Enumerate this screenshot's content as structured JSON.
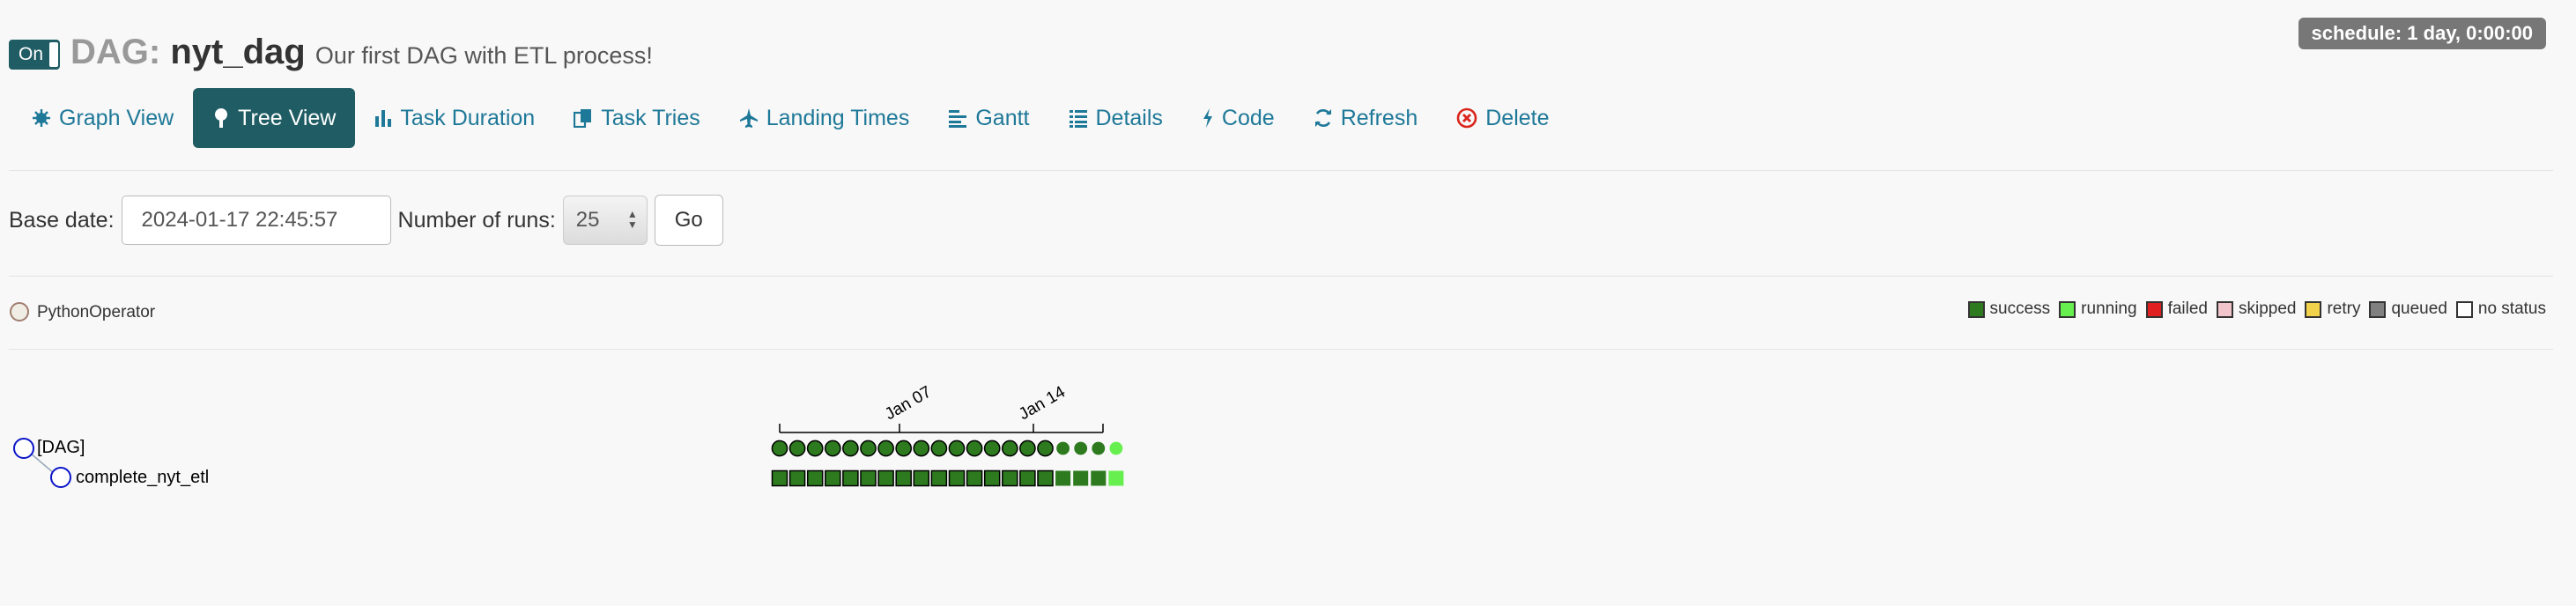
{
  "header": {
    "toggle_label": "On",
    "title_prefix": "DAG:",
    "dag_id": "nyt_dag",
    "description": "Our first DAG with ETL process!",
    "schedule": "schedule: 1 day, 0:00:00"
  },
  "tabs": [
    {
      "label": "Graph View",
      "icon": "graph-icon",
      "active": false
    },
    {
      "label": "Tree View",
      "icon": "tree-icon",
      "active": true
    },
    {
      "label": "Task Duration",
      "icon": "bar-chart-icon",
      "active": false
    },
    {
      "label": "Task Tries",
      "icon": "copy-icon",
      "active": false
    },
    {
      "label": "Landing Times",
      "icon": "plane-icon",
      "active": false
    },
    {
      "label": "Gantt",
      "icon": "align-left-icon",
      "active": false
    },
    {
      "label": "Details",
      "icon": "list-icon",
      "active": false
    },
    {
      "label": "Code",
      "icon": "flash-icon",
      "active": false
    },
    {
      "label": "Refresh",
      "icon": "refresh-icon",
      "active": false
    },
    {
      "label": "Delete",
      "icon": "remove-circle-icon",
      "active": false
    }
  ],
  "form": {
    "base_date_label": "Base date:",
    "base_date_value": "2024-01-17 22:45:57",
    "num_runs_label": "Number of runs:",
    "num_runs_value": "25",
    "go_label": "Go"
  },
  "operators": [
    {
      "label": "PythonOperator",
      "color": "#f0ede4",
      "stroke": "#a07e70"
    }
  ],
  "legend": [
    {
      "label": "success",
      "color": "#2d7a1f"
    },
    {
      "label": "running",
      "color": "#66ef4f"
    },
    {
      "label": "failed",
      "color": "#e02020"
    },
    {
      "label": "skipped",
      "color": "#f2c4cc"
    },
    {
      "label": "retry",
      "color": "#f2d14b"
    },
    {
      "label": "queued",
      "color": "#808080"
    },
    {
      "label": "no status",
      "color": "#ffffff"
    }
  ],
  "tree": {
    "nodes": [
      {
        "label": "[DAG]"
      },
      {
        "label": "complete_nyt_etl"
      }
    ],
    "axis_ticks": [
      "Jan 07",
      "Jan 14"
    ],
    "runs": [
      "success",
      "success",
      "success",
      "success",
      "success",
      "success",
      "success",
      "success",
      "success",
      "success",
      "success",
      "success",
      "success",
      "success",
      "success",
      "success",
      "success",
      "success",
      "success",
      "running"
    ],
    "colors": {
      "success": "#2d7a1f",
      "running": "#66ef4f"
    }
  }
}
